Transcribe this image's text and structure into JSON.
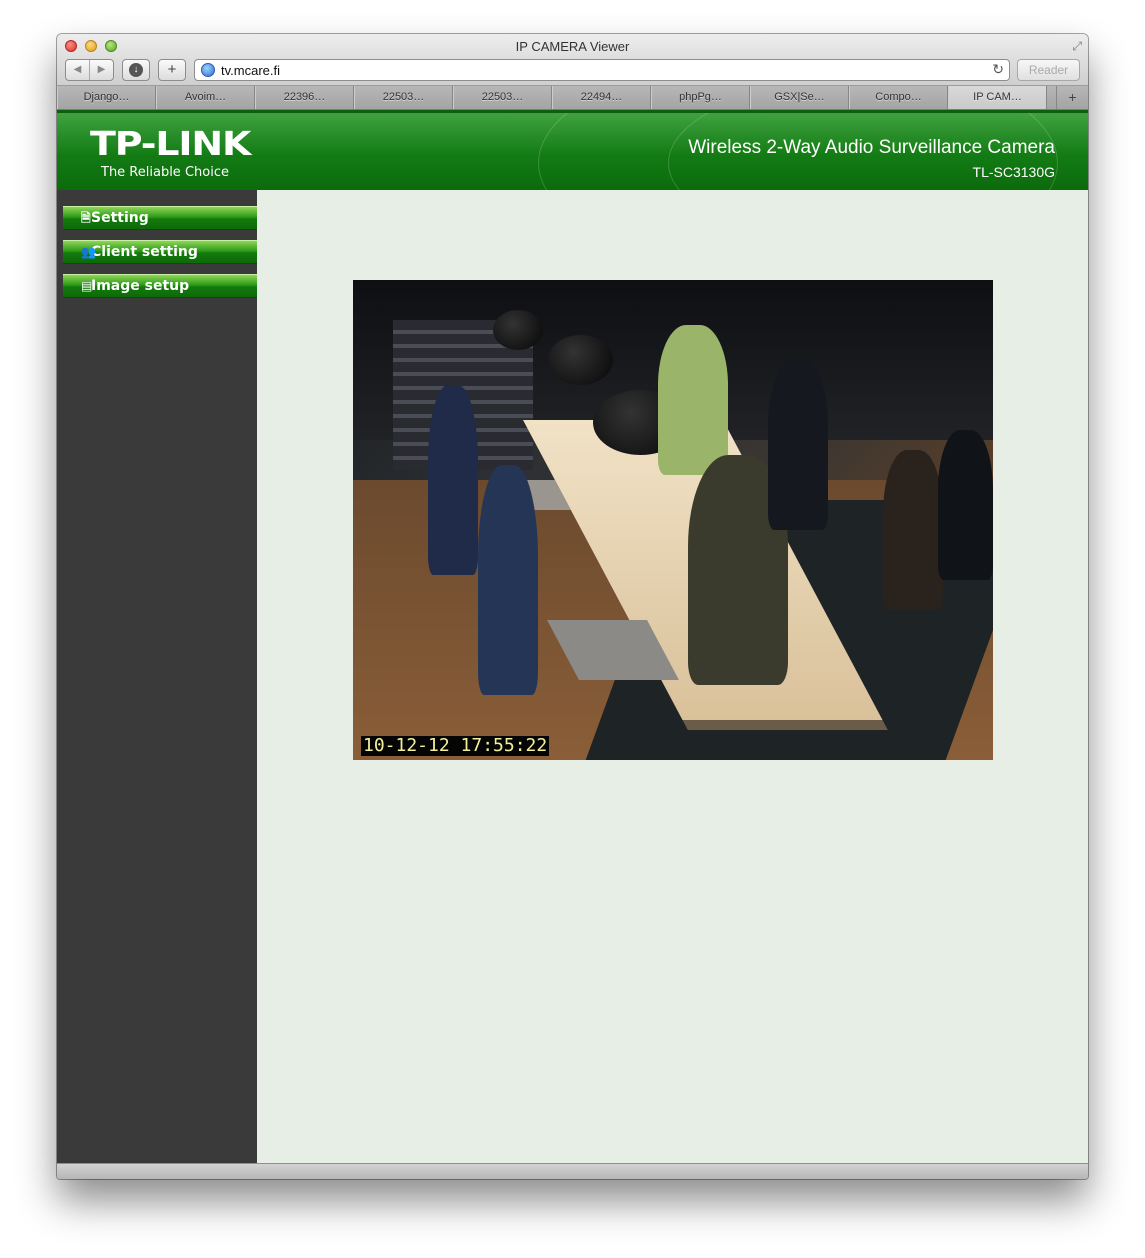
{
  "window": {
    "title": "IP CAMERA Viewer"
  },
  "toolbar": {
    "back_icon": "◀",
    "forward_icon": "▶",
    "download_icon": "↓",
    "add_icon": "+",
    "url": "tv.mcare.fi",
    "reload_icon": "↻",
    "reader_label": "Reader"
  },
  "tabs": [
    {
      "label": "Django…"
    },
    {
      "label": "Avoim…"
    },
    {
      "label": "22396…"
    },
    {
      "label": "22503…"
    },
    {
      "label": "22503…"
    },
    {
      "label": "22494…"
    },
    {
      "label": "phpPg…"
    },
    {
      "label": "GSX|Se…"
    },
    {
      "label": "Compo…"
    },
    {
      "label": "IP CAM…"
    }
  ],
  "newtab_icon": "+",
  "header": {
    "logo": "TP-LINK",
    "tagline": "The Reliable Choice",
    "product_name": "Wireless 2-Way Audio Surveillance Camera",
    "model": "TL-SC3130G"
  },
  "sidebar": {
    "items": [
      {
        "label": "Setting",
        "icon": "document-icon"
      },
      {
        "label": "Client setting",
        "icon": "users-icon"
      },
      {
        "label": "Image setup",
        "icon": "image-setup-icon"
      }
    ]
  },
  "camera": {
    "timestamp": "10-12-12  17:55:22"
  },
  "colors": {
    "header_green": "#137b14",
    "sidebar_bg": "#3a3a3a",
    "content_bg": "#e6eee6",
    "timestamp_text": "#f4f099"
  }
}
